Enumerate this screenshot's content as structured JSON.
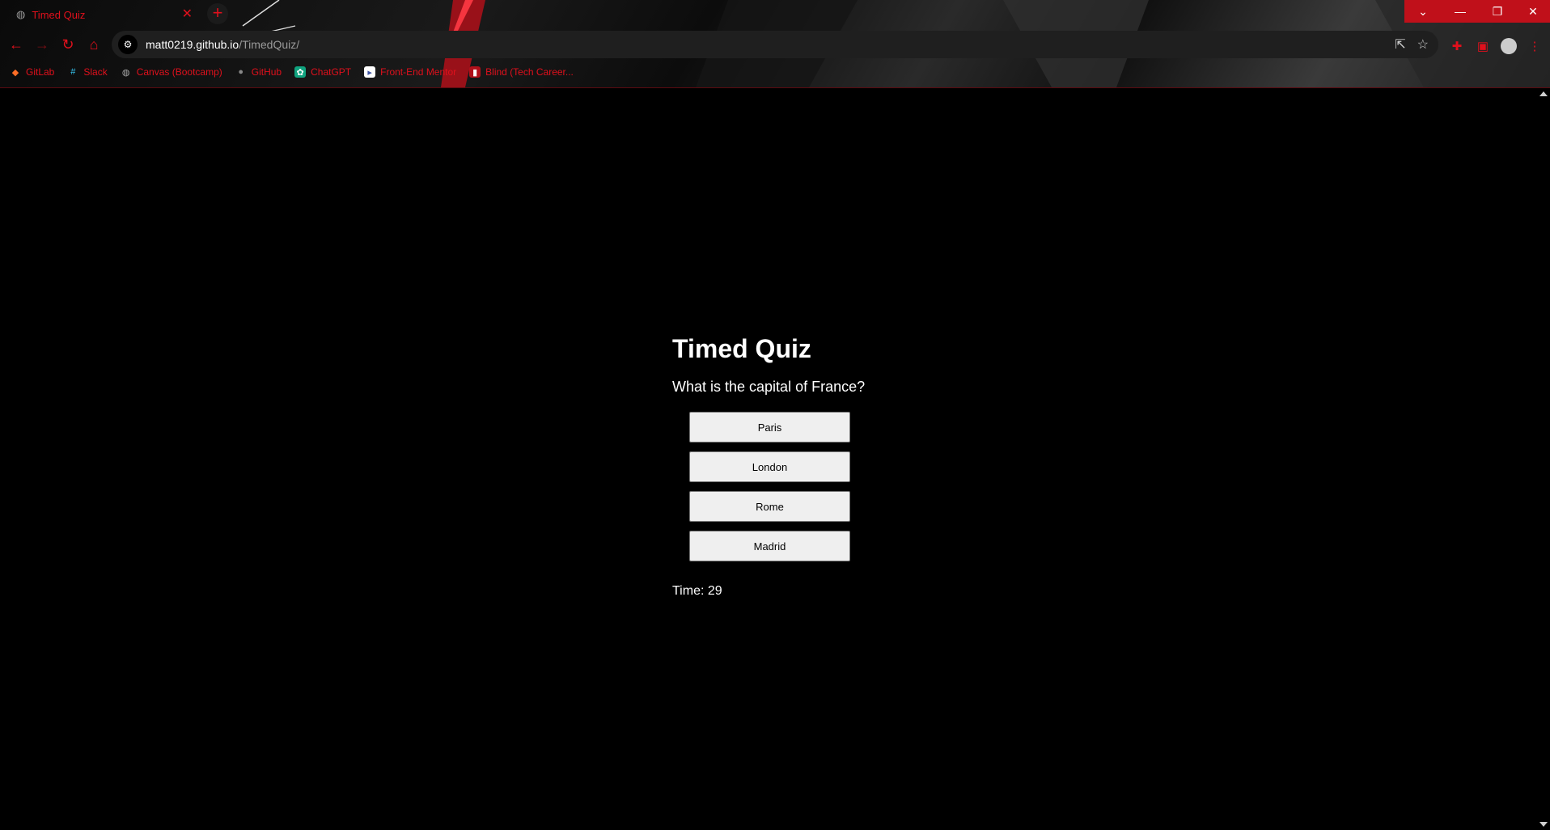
{
  "browser": {
    "tab": {
      "title": "Timed Quiz",
      "close": "✕",
      "icon": "globe-icon"
    },
    "new_tab": "+",
    "window_controls": {
      "tab_search": "⌄",
      "minimize": "—",
      "restore": "❐",
      "close": "✕"
    },
    "nav": {
      "back": "←",
      "forward": "→",
      "reload": "↻",
      "home": "⌂"
    },
    "address": {
      "host": "matt0219.github.io",
      "path": "/TimedQuiz/",
      "site_info_icon": "tune-icon"
    },
    "bookmarks": [
      {
        "label": "GitLab",
        "icon": "gitlab-icon"
      },
      {
        "label": "Slack",
        "icon": "slack-icon"
      },
      {
        "label": "Canvas (Bootcamp)",
        "icon": "globe-icon"
      },
      {
        "label": "GitHub",
        "icon": "github-icon"
      },
      {
        "label": "ChatGPT",
        "icon": "chatgpt-icon"
      },
      {
        "label": "Front-End Mentor",
        "icon": "frontend-mentor-icon"
      },
      {
        "label": "Blind (Tech Career...",
        "icon": "blind-icon"
      }
    ],
    "accent_color": "#e0101c"
  },
  "quiz": {
    "title": "Timed Quiz",
    "question": "What is the capital of France?",
    "answers": [
      "Paris",
      "London",
      "Rome",
      "Madrid"
    ],
    "timer": "Time: 29"
  }
}
